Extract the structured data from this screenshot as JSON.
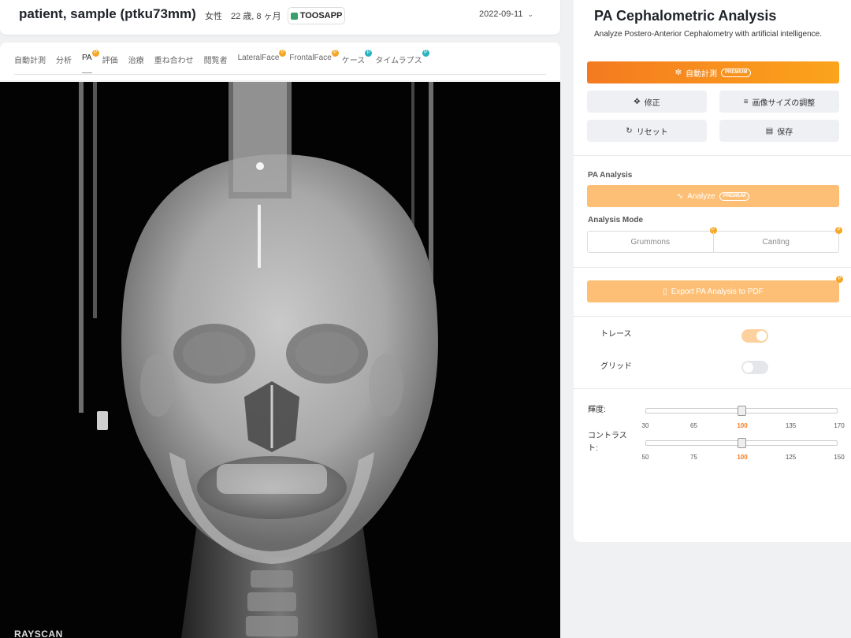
{
  "header": {
    "patient_name": "patient, sample (ptku73mm)",
    "sex": "女性",
    "age": "22 歳, 8 ヶ月",
    "logo_text": "TOOSAPP",
    "date": "2022-09-11"
  },
  "tabs": [
    {
      "label": "自動計測",
      "badge": ""
    },
    {
      "label": "分析",
      "badge": ""
    },
    {
      "label": "PA",
      "badge": "P",
      "active": true
    },
    {
      "label": "評価",
      "badge": ""
    },
    {
      "label": "治療",
      "badge": ""
    },
    {
      "label": "重ね合わせ",
      "badge": ""
    },
    {
      "label": "閲覧者",
      "badge": ""
    },
    {
      "label": "LateralFace",
      "badge": "P"
    },
    {
      "label": "FrontalFace",
      "badge": "P"
    },
    {
      "label": "ケース",
      "badge": "P"
    },
    {
      "label": "タイムラプス",
      "badge": "P"
    }
  ],
  "viewer": {
    "watermark": "RAYSCAN"
  },
  "panel": {
    "title": "PA Cephalometric Analysis",
    "description": "Analyze Postero-Anterior Cephalometry with artificial intelligence.",
    "auto_measure_label": "自動計測",
    "premium_badge": "PREMIUM",
    "edit_label": "修正",
    "resize_label": "画像サイズの調整",
    "reset_label": "リセット",
    "save_label": "保存",
    "pa_analysis_heading": "PA Analysis",
    "analyze_label": "Analyze",
    "analysis_mode_heading": "Analysis Mode",
    "mode_options": [
      "Grummons",
      "Canting"
    ],
    "export_label": "Export PA Analysis to PDF",
    "trace_label": "トレース",
    "trace_on": true,
    "grid_label": "グリッド",
    "grid_on": false,
    "brightness": {
      "label": "輝度:",
      "ticks": [
        "30",
        "65",
        "100",
        "135",
        "170"
      ],
      "min": 30,
      "max": 170,
      "value": 100
    },
    "contrast": {
      "label": "コントラスト:",
      "ticks": [
        "50",
        "75",
        "100",
        "125",
        "150"
      ],
      "min": 50,
      "max": 150,
      "value": 100
    }
  },
  "colors": {
    "accent_orange": "#f47a1f",
    "accent_light_orange": "#fdbf75",
    "badge_orange": "#f5a623",
    "badge_teal": "#2bb3c0"
  }
}
